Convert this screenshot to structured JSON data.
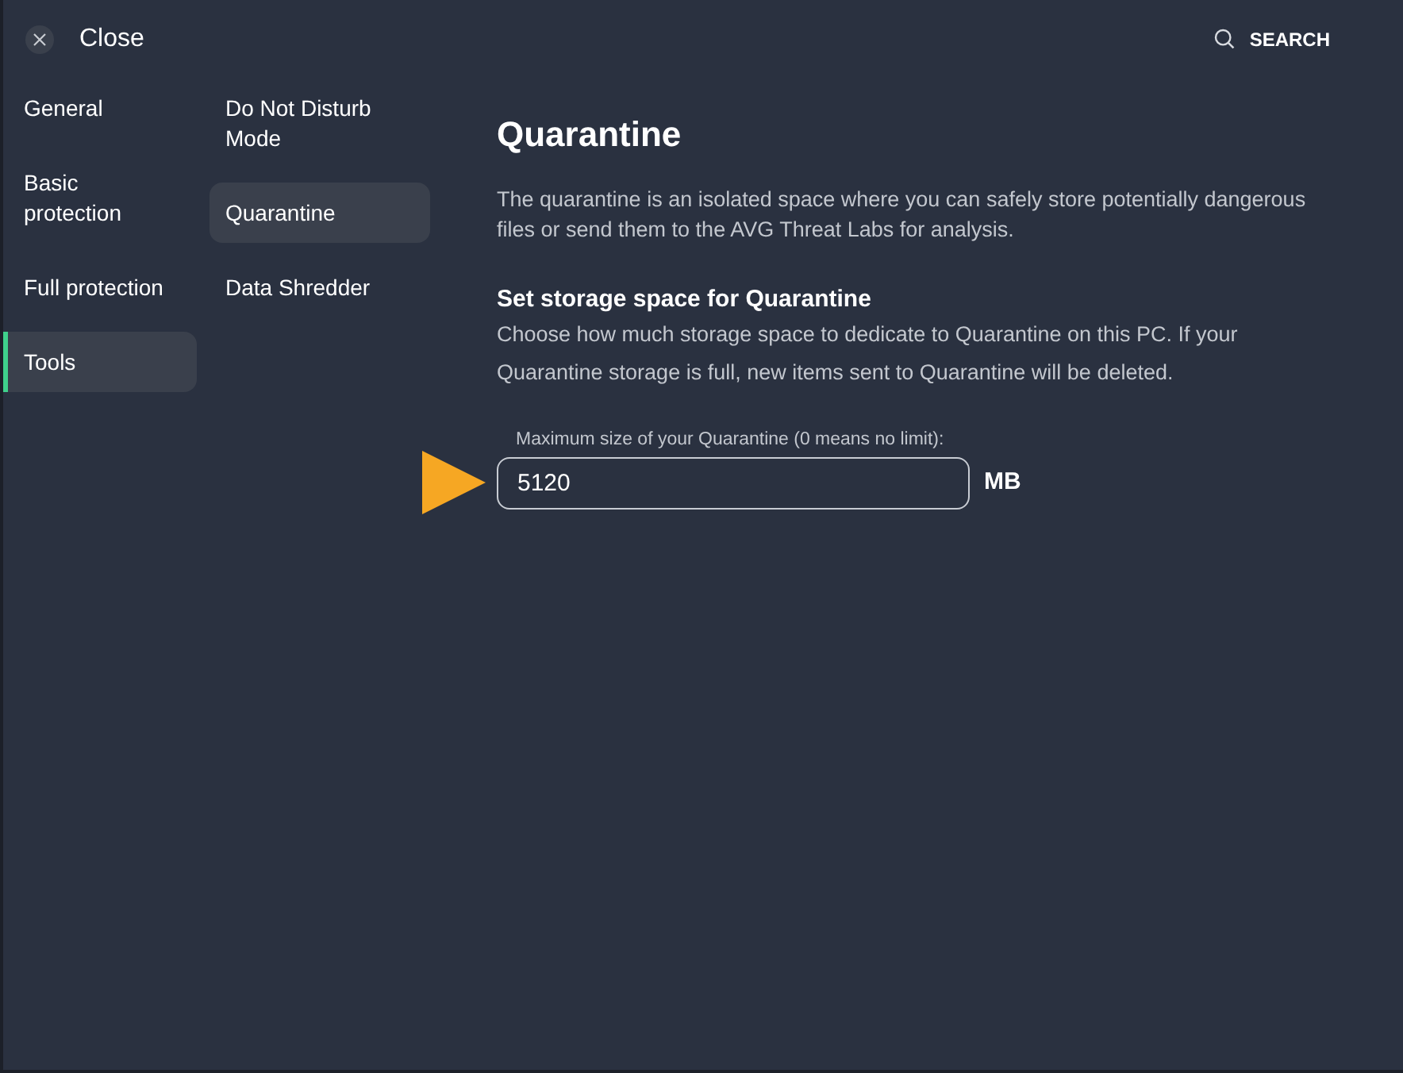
{
  "header": {
    "close_label": "Close",
    "search_label": "SEARCH"
  },
  "categories": [
    {
      "label": "General",
      "selected": false
    },
    {
      "label": "Basic protection",
      "selected": false
    },
    {
      "label": "Full protection",
      "selected": false
    },
    {
      "label": "Tools",
      "selected": true
    }
  ],
  "subcategories": [
    {
      "label": "Do Not Disturb Mode",
      "selected": false
    },
    {
      "label": "Quarantine",
      "selected": true
    },
    {
      "label": "Data Shredder",
      "selected": false
    }
  ],
  "content": {
    "title": "Quarantine",
    "description": "The quarantine is an isolated space where you can safely store potentially dangerous files or send them to the AVG Threat Labs for analysis.",
    "section_title": "Set storage space for Quarantine",
    "section_text": "Choose how much storage space to dedicate to Quarantine on this PC. If your Quarantine storage is full, new items sent to Quarantine will be deleted.",
    "field": {
      "label": "Maximum size of your Quarantine (0 means no limit):",
      "value": "5120",
      "unit": "MB"
    }
  }
}
